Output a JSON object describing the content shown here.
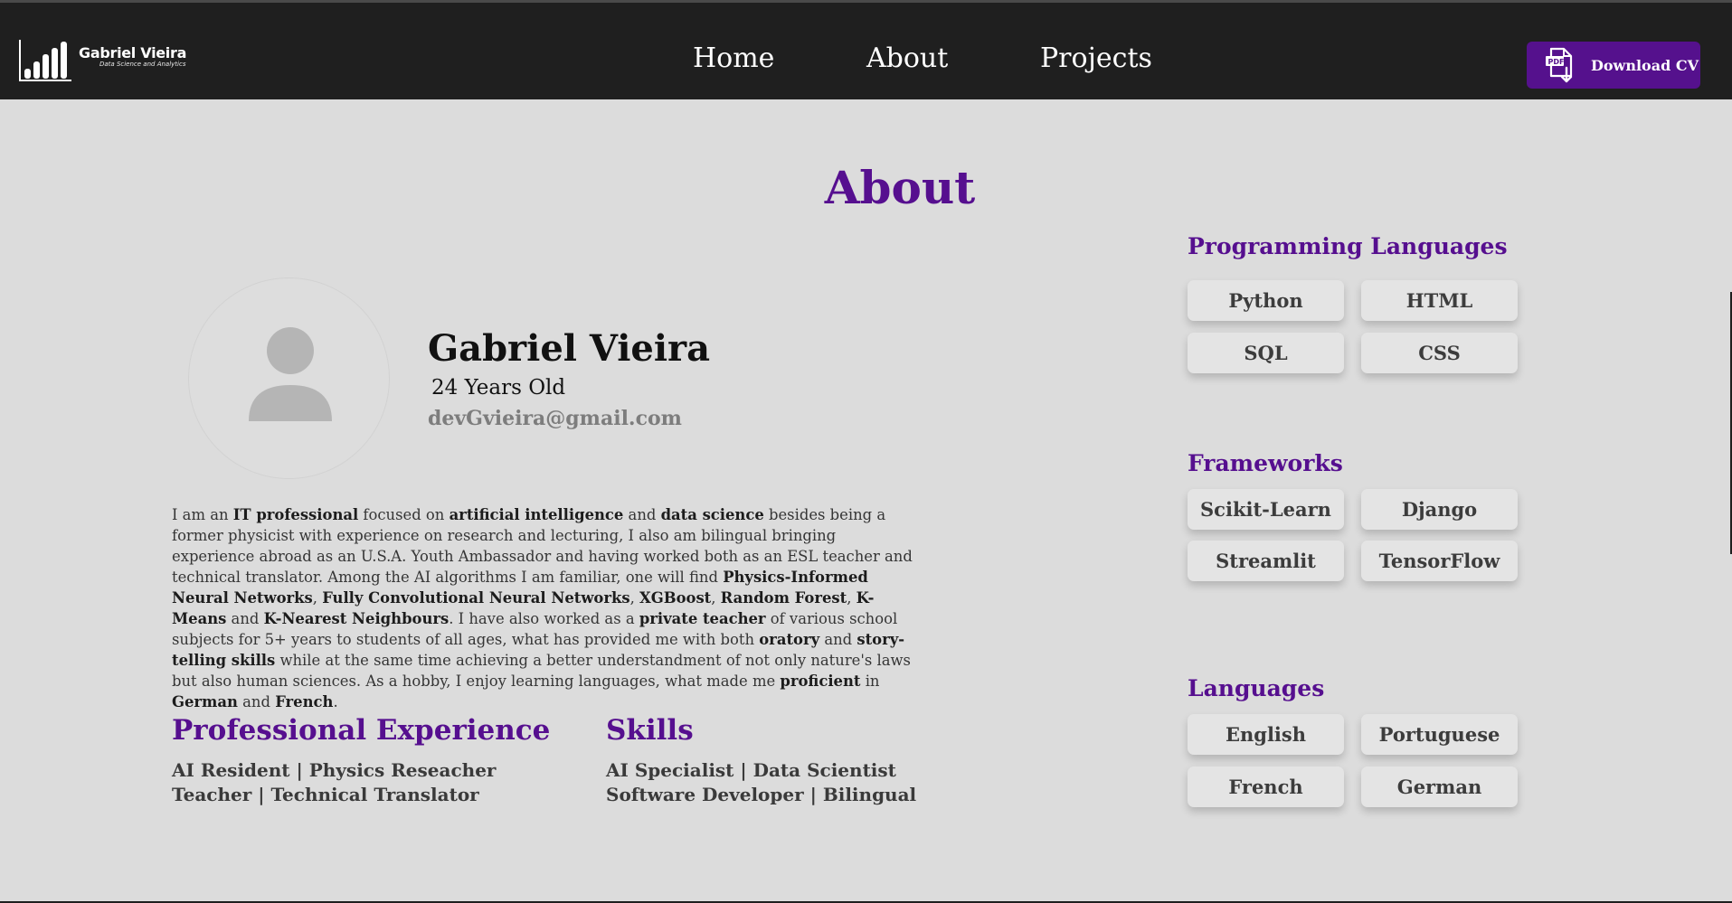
{
  "brand": {
    "name": "Gabriel Vieira",
    "tagline": "Data Science and Analytics"
  },
  "nav": {
    "items": [
      {
        "label": "Home"
      },
      {
        "label": "About"
      },
      {
        "label": "Projects"
      }
    ],
    "download_cv": {
      "label": "Download CV",
      "icon": "pdf-download-icon"
    }
  },
  "page": {
    "title": "About"
  },
  "profile": {
    "name": "Gabriel Vieira",
    "age": "24 Years Old",
    "email": "devGvieira@gmail.com",
    "avatar_icon": "user-placeholder-icon"
  },
  "bio": [
    {
      "t": "I am an ",
      "b": false
    },
    {
      "t": "IT professional",
      "b": true
    },
    {
      "t": " focused on ",
      "b": false
    },
    {
      "t": "artificial intelligence",
      "b": true
    },
    {
      "t": " and ",
      "b": false
    },
    {
      "t": "data science",
      "b": true
    },
    {
      "t": " besides being a former physicist with experience on research and lecturing, I also am bilingual bringing experience abroad as an U.S.A. Youth Ambassador and having worked both as an ESL teacher and technical translator. Among the AI algorithms I am familiar, one will find ",
      "b": false
    },
    {
      "t": "Physics-Informed Neural Networks",
      "b": true
    },
    {
      "t": ", ",
      "b": false
    },
    {
      "t": "Fully Convolutional Neural Networks",
      "b": true
    },
    {
      "t": ", ",
      "b": false
    },
    {
      "t": "XGBoost",
      "b": true
    },
    {
      "t": ", ",
      "b": false
    },
    {
      "t": "Random Forest",
      "b": true
    },
    {
      "t": ", ",
      "b": false
    },
    {
      "t": "K-Means",
      "b": true
    },
    {
      "t": " and ",
      "b": false
    },
    {
      "t": "K-Nearest Neighbours",
      "b": true
    },
    {
      "t": ". I have also worked as a ",
      "b": false
    },
    {
      "t": "private teacher",
      "b": true
    },
    {
      "t": " of various school subjects for 5+ years to students of all ages, what has provided me with both ",
      "b": false
    },
    {
      "t": "oratory",
      "b": true
    },
    {
      "t": " and ",
      "b": false
    },
    {
      "t": "story-telling skills",
      "b": true
    },
    {
      "t": " while at the same time achieving a better understandment of not only nature's laws but also human sciences. As a hobby, I enjoy learning languages, what made me ",
      "b": false
    },
    {
      "t": "proficient",
      "b": true
    },
    {
      "t": " in ",
      "b": false
    },
    {
      "t": "German",
      "b": true
    },
    {
      "t": " and ",
      "b": false
    },
    {
      "t": "French",
      "b": true
    },
    {
      "t": ".",
      "b": false
    }
  ],
  "experience": {
    "title": "Professional Experience",
    "lines": [
      "AI Resident | Physics Reseacher",
      "Teacher | Technical Translator"
    ]
  },
  "skills": {
    "title": "Skills",
    "lines": [
      "AI Specialist | Data Scientist",
      "Software Developer | Bilingual"
    ]
  },
  "sidebar": {
    "programming": {
      "title": "Programming Languages",
      "tags": [
        "Python",
        "HTML",
        "SQL",
        "CSS"
      ]
    },
    "frameworks": {
      "title": "Frameworks",
      "tags": [
        "Scikit-Learn",
        "Django",
        "Streamlit",
        "TensorFlow"
      ]
    },
    "languages": {
      "title": "Languages",
      "tags": [
        "English",
        "Portuguese",
        "French",
        "German"
      ]
    }
  },
  "colors": {
    "navbar": "#1f1f1f",
    "accent": "#560f8f",
    "background": "#dcdcdc",
    "tag_bg": "#e4e4e4"
  }
}
